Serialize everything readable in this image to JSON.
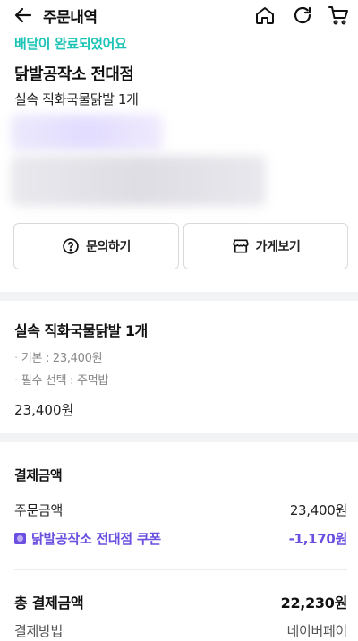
{
  "header": {
    "title": "주문내역",
    "back_icon": "arrow-left-icon",
    "home_icon": "home-icon",
    "refresh_icon": "refresh-icon",
    "cart_icon": "cart-icon"
  },
  "order": {
    "status": "배달이 완료되었어요",
    "store_name": "닭발공작소 전대점",
    "item_summary": "실속 직화국물닭발 1개"
  },
  "actions": {
    "inquiry_label": "문의하기",
    "store_label": "가게보기"
  },
  "item": {
    "name": "실속 직화국물닭발 1개",
    "options": [
      "기본 : 23,400원",
      "필수 선택 : 주먹밥"
    ],
    "price": "23,400원"
  },
  "payment": {
    "section_title": "결제금액",
    "order_amount_label": "주문금액",
    "order_amount_value": "23,400원",
    "coupon_label": "닭발공작소 전대점 쿠폰",
    "coupon_value": "-1,170원",
    "total_label": "총 결제금액",
    "total_value": "22,230원",
    "method_label": "결제방법",
    "method_value": "네이버페이"
  },
  "colors": {
    "status_teal": "#1cc4b5",
    "coupon_purple": "#6b4fe0"
  }
}
